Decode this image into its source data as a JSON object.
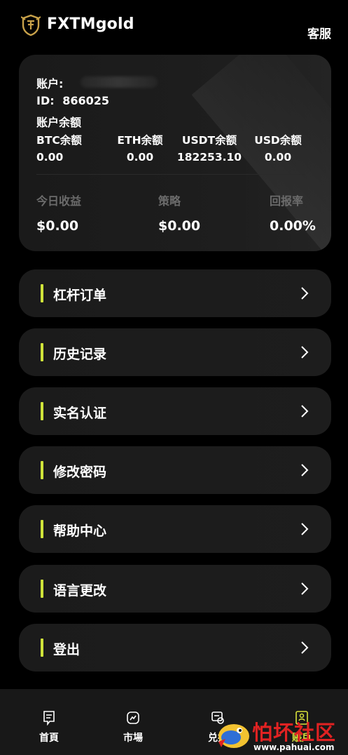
{
  "header": {
    "app_title": "FXTMgold",
    "service_label": "客服",
    "logo_icon": "shield-logo-icon"
  },
  "account": {
    "account_label": "账户:",
    "id_label": "ID:",
    "id_value": "866025",
    "balance_title": "账户余额",
    "balances": [
      {
        "label": "BTC余额",
        "value": "0.00"
      },
      {
        "label": "ETH余额",
        "value": "0.00"
      },
      {
        "label": "USDT余额",
        "value": "182253.10"
      },
      {
        "label": "USD余额",
        "value": "0.00"
      }
    ],
    "stats": [
      {
        "label": "今日收益",
        "value": "$0.00"
      },
      {
        "label": "策略",
        "value": "$0.00"
      },
      {
        "label": "回报率",
        "value": "0.00%"
      }
    ]
  },
  "menu": {
    "items": [
      {
        "label": "杠杆订单"
      },
      {
        "label": "历史记录"
      },
      {
        "label": "实名认证"
      },
      {
        "label": "修改密码"
      },
      {
        "label": "帮助中心"
      },
      {
        "label": "语言更改"
      },
      {
        "label": "登出"
      }
    ]
  },
  "bottom_nav": {
    "items": [
      {
        "label": "首頁",
        "icon": "home-chat-icon"
      },
      {
        "label": "市場",
        "icon": "chart-trend-icon"
      },
      {
        "label": "兑换",
        "icon": "exchange-icon"
      },
      {
        "label": "賬戶",
        "icon": "account-icon"
      }
    ],
    "active_index": 3
  },
  "watermark": {
    "main_text": "怕坏社区",
    "url_text": "www.pahuai.com"
  },
  "colors": {
    "background": "#000000",
    "card": "#1c1c1c",
    "accent": "#cfe33a",
    "muted_text": "#6b6b6b",
    "nav_background": "#181818"
  }
}
